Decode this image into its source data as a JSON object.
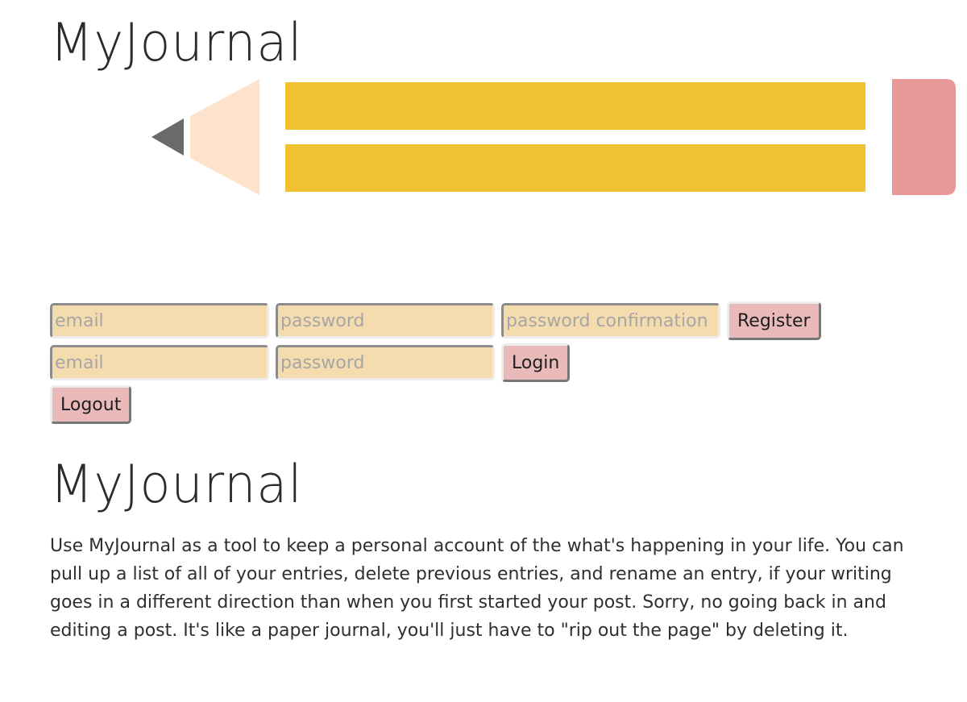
{
  "header": {
    "logo_text": "MyJournal"
  },
  "colors": {
    "pencil_body": "#f0c232",
    "pencil_wood": "#fde3cb",
    "pencil_lead": "#6a6a6a",
    "pencil_eraser": "#e89898",
    "field_bg": "#f5dcae",
    "button_bg": "#eab9b9"
  },
  "register_form": {
    "email_placeholder": "email",
    "password_placeholder": "password",
    "password_confirmation_placeholder": "password confirmation",
    "submit_label": "Register"
  },
  "login_form": {
    "email_placeholder": "email",
    "password_placeholder": "password",
    "submit_label": "Login"
  },
  "logout": {
    "label": "Logout"
  },
  "main": {
    "title": "MyJournal",
    "description": "Use MyJournal as a tool to keep a personal account of the what's happening in your life. You can pull up a list of all of your entries, delete previous entries, and rename an entry, if your writing goes in a different direction than when you first started your post. Sorry, no going back in and editing a post. It's like a paper journal, you'll just have to \"rip out the page\" by deleting it."
  }
}
